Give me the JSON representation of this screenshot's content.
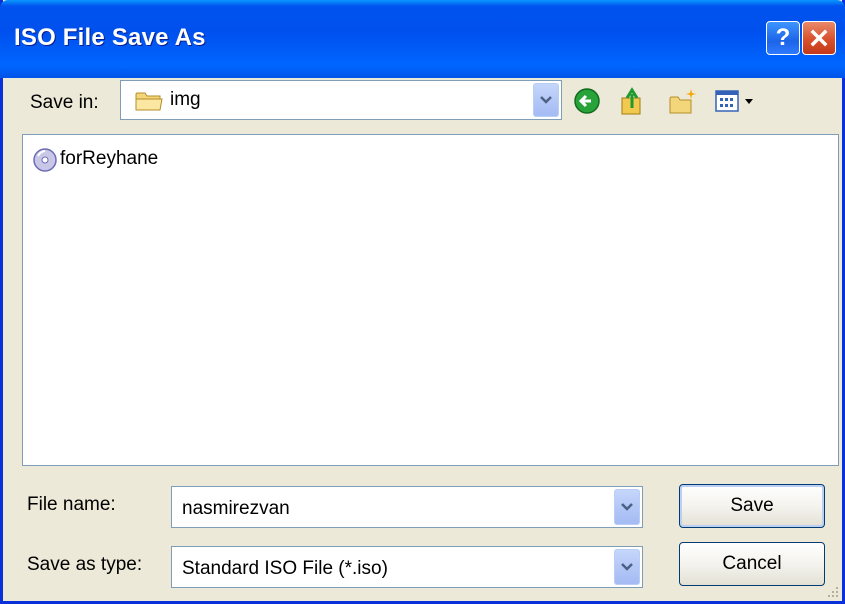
{
  "window": {
    "title": "ISO File Save As",
    "help_glyph": "?",
    "icons": {
      "help": "help-icon",
      "close": "close-icon"
    }
  },
  "toolbar": {
    "save_in_label": "Save in:",
    "location": "img",
    "icons": [
      "back-arrow-icon",
      "up-folder-icon",
      "new-folder-icon",
      "view-menu-icon"
    ]
  },
  "file_list": {
    "items": [
      {
        "name": "forReyhane",
        "icon": "iso-file-icon"
      }
    ]
  },
  "form": {
    "file_name_label": "File name:",
    "file_name_value": "nasmirezvan",
    "save_as_type_label": "Save as type:",
    "save_as_type_value": "Standard ISO File (*.iso)"
  },
  "buttons": {
    "save": "Save",
    "cancel": "Cancel"
  },
  "colors": {
    "titlebar": "#0055ea",
    "window_bg": "#ece9d8",
    "close_red": "#d8502b",
    "border": "#7f9db9"
  }
}
